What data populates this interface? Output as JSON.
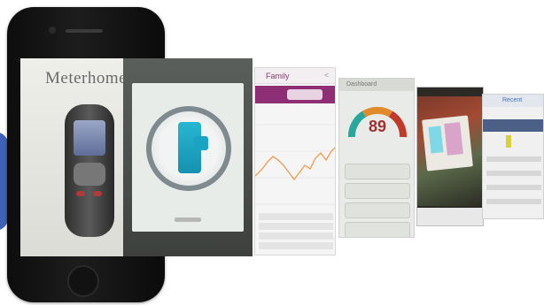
{
  "phone": {
    "app_title": "Meterhome"
  },
  "screen3": {
    "title": "Family"
  },
  "screen4": {
    "title": "Dashboard",
    "gauge_value": "89"
  },
  "screen6": {
    "title": "Recent"
  },
  "colors": {
    "brand_purple": "#8e2f76",
    "gauge_red": "#c0392b",
    "gauge_orange": "#e08a2c",
    "gauge_teal": "#2aa79b",
    "accent_blue": "#3f62b8",
    "pair_cyan": "#27b6d1"
  }
}
